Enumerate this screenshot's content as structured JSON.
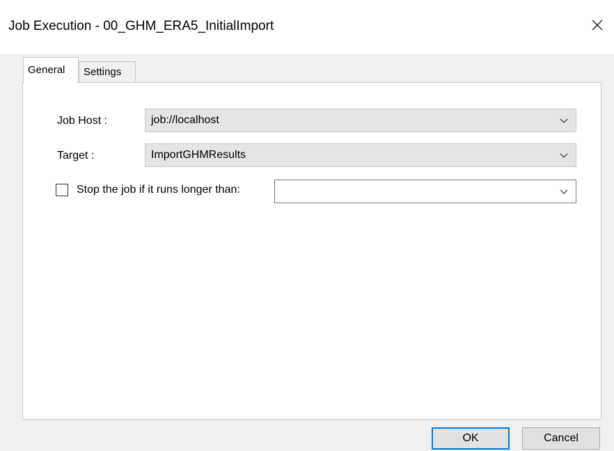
{
  "window": {
    "title": "Job Execution - 00_GHM_ERA5_InitialImport",
    "close_glyph": "✕"
  },
  "tabs": [
    {
      "label": "General",
      "selected": true
    },
    {
      "label": "Settings",
      "selected": false
    }
  ],
  "general": {
    "job_host": {
      "label": "Job Host :",
      "value": "job://localhost"
    },
    "target": {
      "label": "Target :",
      "value": "ImportGHMResults"
    },
    "timeout": {
      "checkbox_label": "Stop the job if it runs longer than:",
      "checked": false,
      "value": ""
    }
  },
  "buttons": {
    "ok": "OK",
    "cancel": "Cancel"
  },
  "icons": {
    "close": "close-icon",
    "dropdown": "chevron-down-icon"
  },
  "colors": {
    "accent": "#0078d7",
    "window_bg": "#f0f0f0",
    "combo_bg": "#e5e5e5"
  }
}
